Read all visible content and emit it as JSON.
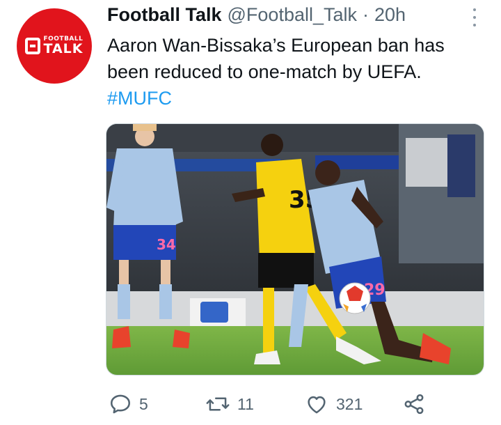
{
  "tweet": {
    "author_name": "Football Talk",
    "author_handle": "@Football_Talk",
    "separator": "·",
    "time": "20h",
    "text": "Aaron Wan-Bissaka’s European ban has been reduced to one-match by UEFA.",
    "hashtag": "#MUFC"
  },
  "avatar": {
    "logo_top": "FOOTBALL",
    "logo_bottom": "TALK",
    "color": "#e1141c"
  },
  "media": {
    "jersey_left": "34",
    "jersey_yellow": "35",
    "jersey_right": "29"
  },
  "actions": {
    "reply_count": "5",
    "retweet_count": "11",
    "like_count": "321"
  },
  "icons": {
    "more": "more-dots-icon",
    "reply": "reply-icon",
    "retweet": "retweet-icon",
    "like": "heart-icon",
    "share": "share-icon"
  },
  "colors": {
    "name": "#0f1419",
    "secondary": "#536471",
    "link": "#1d9bf0"
  }
}
